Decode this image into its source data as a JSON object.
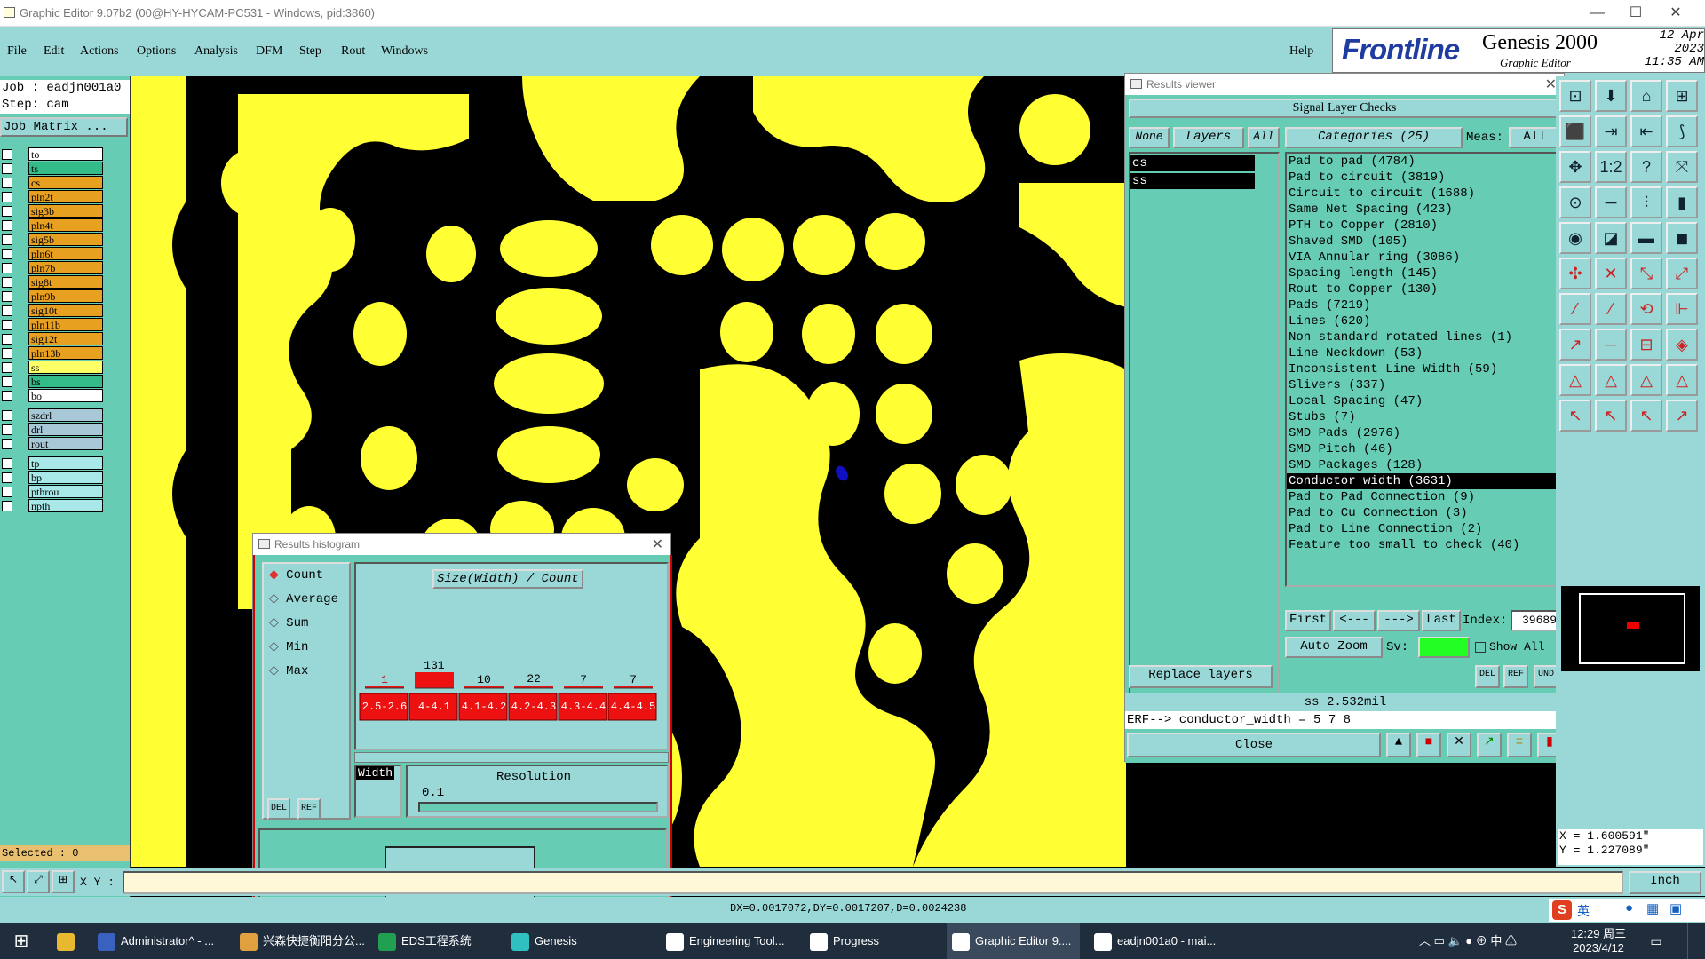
{
  "window": {
    "title": "Graphic Editor 9.07b2 (00@HY-HYCAM-PC531 - Windows, pid:3860)",
    "minimize": "—",
    "maximize": "☐",
    "close": "✕"
  },
  "menu": {
    "items": [
      "File",
      "Edit",
      "Actions",
      "Options",
      "Analysis",
      "DFM",
      "Step",
      "Rout",
      "Windows"
    ],
    "help": "Help"
  },
  "logo": {
    "brand": "Frontline",
    "product": "Genesis 2000",
    "subtitle": "Graphic Editor",
    "date": "12 Apr 2023",
    "time": "11:35 AM"
  },
  "job": {
    "job_line": "Job : eadjn001a0",
    "step_line": "Step: cam",
    "matrix_button": "Job Matrix ..."
  },
  "layers": [
    {
      "name": "to",
      "color": "#ffffff"
    },
    {
      "name": "ts",
      "color": "#33bb88"
    },
    {
      "name": "cs",
      "color": "#e8a020"
    },
    {
      "name": "pln2t",
      "color": "#e8a020"
    },
    {
      "name": "sig3b",
      "color": "#e8a020"
    },
    {
      "name": "pln4t",
      "color": "#e8a020"
    },
    {
      "name": "sig5b",
      "color": "#e8a020"
    },
    {
      "name": "pln6t",
      "color": "#e8a020"
    },
    {
      "name": "pln7b",
      "color": "#e8a020"
    },
    {
      "name": "sig8t",
      "color": "#e8a020"
    },
    {
      "name": "pln9b",
      "color": "#e8a020"
    },
    {
      "name": "sig10t",
      "color": "#e8a020"
    },
    {
      "name": "pln11b",
      "color": "#e8a020"
    },
    {
      "name": "sig12t",
      "color": "#e8a020"
    },
    {
      "name": "pln13b",
      "color": "#e8a020"
    },
    {
      "name": "ss",
      "color": "#ffff66"
    },
    {
      "name": "bs",
      "color": "#33bb88"
    },
    {
      "name": "bo",
      "color": "#ffffff"
    },
    {
      "name": "szdrl",
      "color": "#a8c8d8"
    },
    {
      "name": "drl",
      "color": "#a8c8d8"
    },
    {
      "name": "rout",
      "color": "#a8c8d8"
    },
    {
      "name": "tp",
      "color": "#a8e8e8"
    },
    {
      "name": "bp",
      "color": "#a8e8e8"
    },
    {
      "name": "pthrou",
      "color": "#a8e8e8"
    },
    {
      "name": "npth",
      "color": "#a8e8e8"
    }
  ],
  "selected_text": "Selected : 0",
  "results_viewer": {
    "title": "Results viewer",
    "header": "Signal Layer Checks",
    "none_btn": "None",
    "layers_btn": "Layers",
    "all_btn": "All",
    "categories_btn": "Categories (25)",
    "meas_label": "Meas:",
    "meas_value": "All",
    "layer_list": [
      "cs",
      "ss"
    ],
    "categories": [
      "Pad to pad (4784)",
      "Pad to circuit (3819)",
      "Circuit to circuit (1688)",
      "Same Net Spacing (423)",
      "PTH to Copper (2810)",
      "Shaved SMD (105)",
      "VIA Annular ring (3086)",
      "Spacing length (145)",
      "Rout to Copper (130)",
      "Pads (7219)",
      "Lines (620)",
      "Non standard rotated lines (1)",
      "Line Neckdown (53)",
      "Inconsistent Line Width (59)",
      "Slivers (337)",
      "Local Spacing (47)",
      "Stubs (7)",
      "SMD Pads (2976)",
      "SMD Pitch (46)",
      "SMD Packages (128)",
      "Conductor width (3631)",
      "Pad to Pad Connection (9)",
      "Pad to Cu Connection (3)",
      "Pad to Line Connection (2)",
      "Feature too small to check (40)"
    ],
    "selected_category": "Conductor width (3631)",
    "first": "First",
    "prev": "<---",
    "next": "--->",
    "last": "Last",
    "index_label": "Index:",
    "index_value": "39689",
    "auto_zoom": "Auto Zoom",
    "sv_label": "Sv:",
    "show_all": "Show All",
    "replace_layers": "Replace layers",
    "measure": "ss 2.532mil",
    "erf": "ERF--> conductor_width = 5 7 8",
    "close": "Close",
    "del": "DEL",
    "ref": "REF",
    "und": "UND"
  },
  "histogram": {
    "title": "Results histogram",
    "modes": [
      "Count",
      "Average",
      "Sum",
      "Min",
      "Max"
    ],
    "active_mode": "Count",
    "chart_title": "Size(Width) / Count",
    "bins": [
      {
        "label": "2.5-2.6",
        "count": 1
      },
      {
        "label": "4-4.1",
        "count": 131
      },
      {
        "label": "4.1-4.2",
        "count": 10
      },
      {
        "label": "4.2-4.3",
        "count": 22
      },
      {
        "label": "4.3-4.4",
        "count": 7
      },
      {
        "label": "4.4-4.5",
        "count": 7
      }
    ],
    "width_label": "Width",
    "resolution_label": "Resolution",
    "resolution_value": "0.1",
    "del": "DEL",
    "ref": "REF"
  },
  "coords": {
    "x": "X = 1.600591\"",
    "y": "Y = 1.227089\""
  },
  "command": {
    "xy_label": "X Y :",
    "unit": "Inch"
  },
  "status": {
    "delta": "DX=0.0017072,DY=0.0017207,D=0.0024238"
  },
  "taskbar": {
    "items": [
      "Administrator^ - ...",
      "兴森快捷衡阳分公...",
      "EDS工程系统",
      "Genesis",
      "Engineering Tool...",
      "Progress",
      "Graphic Editor 9....",
      "eadjn001a0 - mai..."
    ],
    "clock_time": "12:29 周三",
    "clock_date": "2023/4/12",
    "ime": "英",
    "ime2": "中"
  }
}
